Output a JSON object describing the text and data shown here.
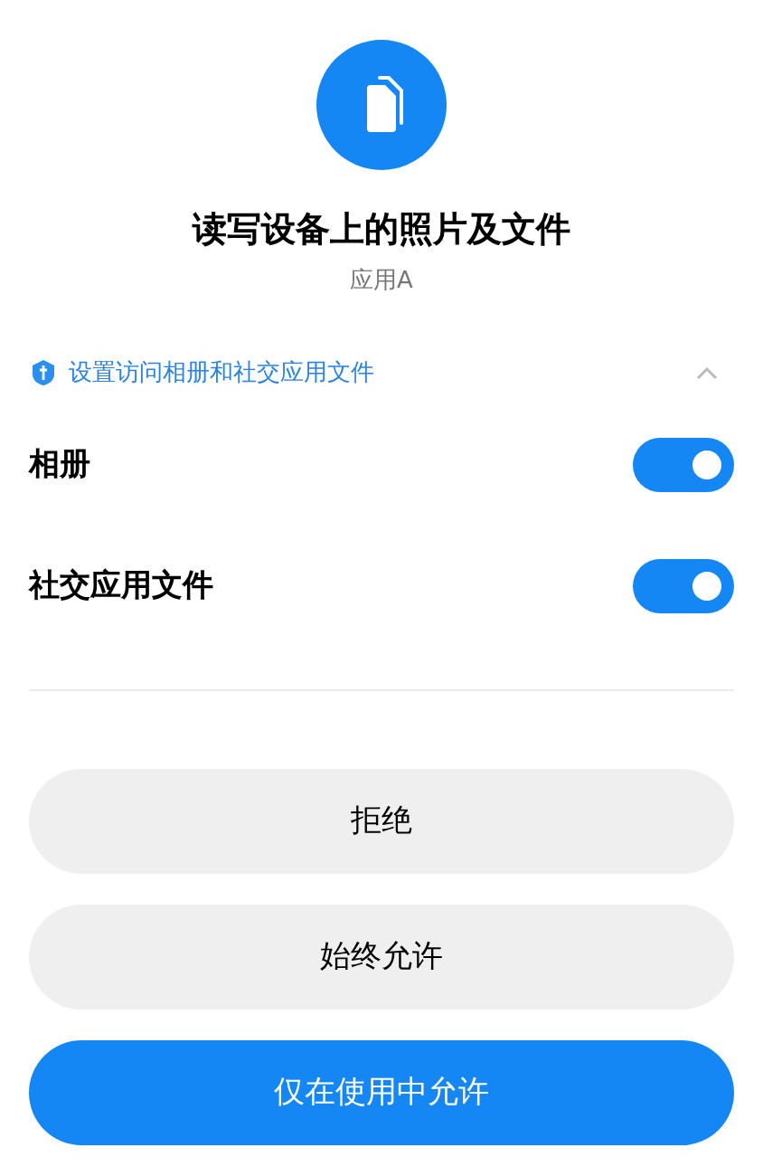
{
  "header": {
    "title": "读写设备上的照片及文件",
    "app_name": "应用A"
  },
  "section": {
    "label": "设置访问相册和社交应用文件",
    "expanded": true,
    "toggles": [
      {
        "label": "相册",
        "on": true
      },
      {
        "label": "社交应用文件",
        "on": true
      }
    ]
  },
  "buttons": [
    {
      "label": "拒绝",
      "kind": "secondary"
    },
    {
      "label": "始终允许",
      "kind": "secondary"
    },
    {
      "label": "仅在使用中允许",
      "kind": "primary"
    }
  ]
}
